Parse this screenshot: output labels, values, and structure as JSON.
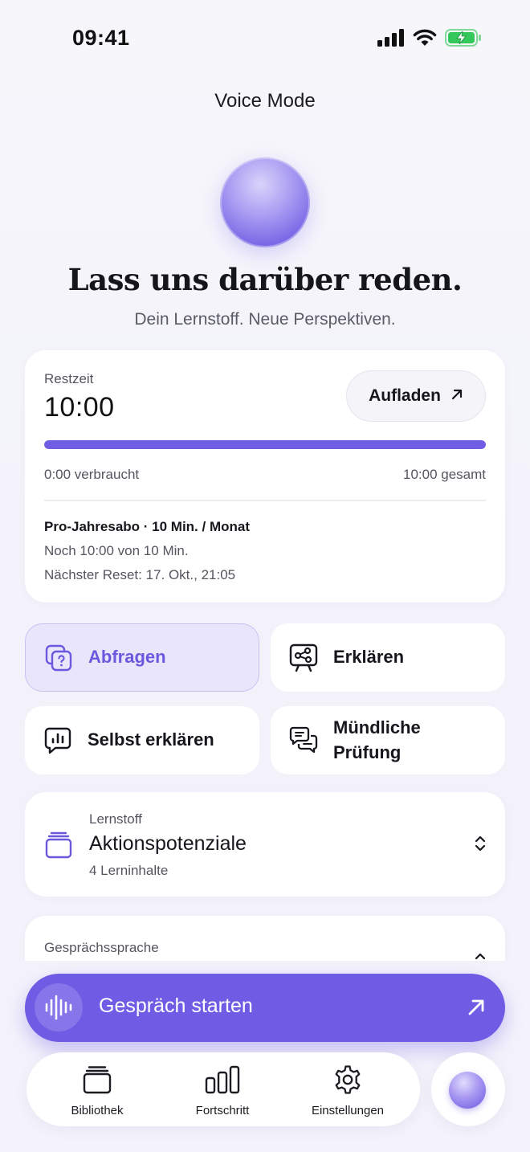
{
  "status_bar": {
    "time": "09:41"
  },
  "header": {
    "title": "Voice Mode"
  },
  "hero": {
    "headline": "Lass uns darüber reden.",
    "subline": "Dein Lernstoff. Neue Perspektiven."
  },
  "time_card": {
    "rest_label": "Restzeit",
    "rest_value": "10:00",
    "topup_label": "Aufladen",
    "progress_fraction": 1.0,
    "used_text": "0:00 verbraucht",
    "total_text": "10:00 gesamt",
    "plan_text": "Pro-Jahresabo · 10 Min. / Monat",
    "remaining_text": "Noch 10:00 von 10 Min.",
    "reset_text": "Nächster Reset: 17. Okt., 21:05"
  },
  "modes": [
    {
      "label": "Abfragen",
      "icon": "quiz-cards-icon",
      "active": true
    },
    {
      "label": "Erklären",
      "icon": "presentation-board-icon",
      "active": false
    },
    {
      "label": "Selbst erklären",
      "icon": "speech-chart-icon",
      "active": false
    },
    {
      "label": "Mündliche Prüfung",
      "label_line1": "Mündliche",
      "label_line2": "Prüfung",
      "icon": "chat-bubbles-icon",
      "active": false
    }
  ],
  "material": {
    "label": "Lernstoff",
    "title": "Aktionspotenziale",
    "count": "4 Lerninhalte"
  },
  "language": {
    "label": "Gesprächssprache"
  },
  "start_button": {
    "label": "Gespräch starten"
  },
  "tabbar": {
    "items": [
      {
        "label": "Bibliothek",
        "icon": "library-stack-icon"
      },
      {
        "label": "Fortschritt",
        "icon": "progress-bars-icon"
      },
      {
        "label": "Einstellungen",
        "icon": "gear-icon"
      }
    ]
  },
  "colors": {
    "accent": "#6e5ce4",
    "accent_light": "#e9e6fb",
    "background": "#f4f3fb",
    "battery_green": "#34c759"
  }
}
